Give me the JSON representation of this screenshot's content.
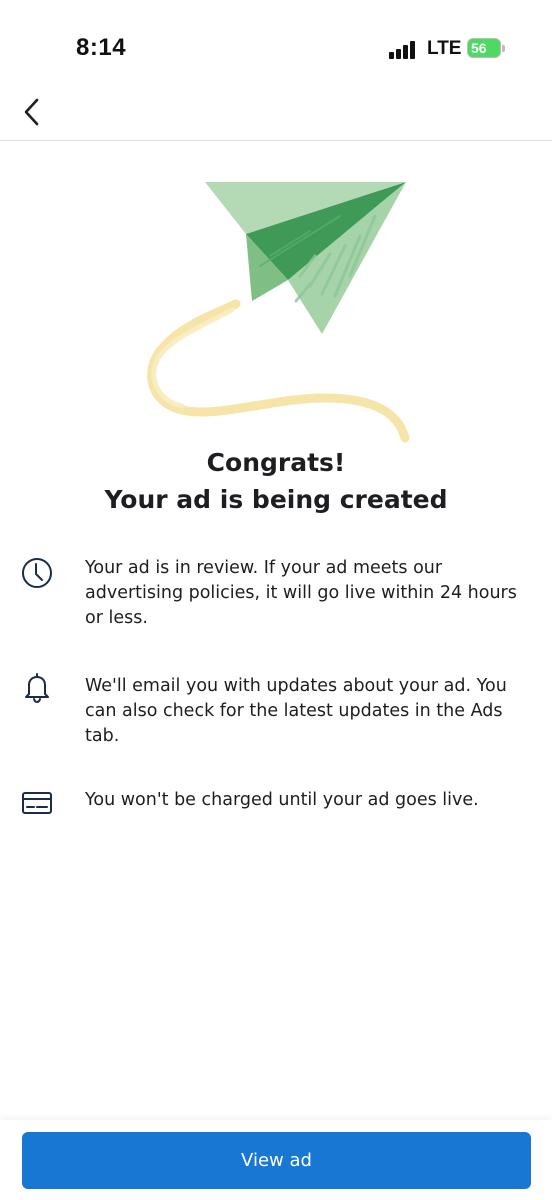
{
  "status_bar": {
    "time": "8:14",
    "network": "LTE",
    "battery_level": "56",
    "signal_icon": "cellular-signal-icon",
    "battery_icon": "battery-charging-icon"
  },
  "nav": {
    "back_icon": "chevron-left-icon"
  },
  "illustration": {
    "icon": "paper-plane-illustration",
    "colors": {
      "plane_light": "#a6d3a8",
      "plane_mid": "#7fbf86",
      "plane_dark": "#3f9a58",
      "trail": "#f6e3a4"
    }
  },
  "headline": {
    "line1": "Congrats!",
    "line2": "Your ad is being created"
  },
  "info_items": [
    {
      "icon": "clock-icon",
      "text": "Your ad is in review. If your ad meets our advertising policies, it will go live within 24 hours or less."
    },
    {
      "icon": "bell-icon",
      "text": "We'll email you with updates about your ad. You can also check for the latest updates in the Ads tab."
    },
    {
      "icon": "credit-card-icon",
      "text": "You won't be charged until your ad goes live."
    }
  ],
  "footer": {
    "view_ad_label": "View ad"
  },
  "colors": {
    "primary_button": "#1877d2",
    "icon_stroke": "#1c2b4a",
    "text": "#1c1e21"
  }
}
